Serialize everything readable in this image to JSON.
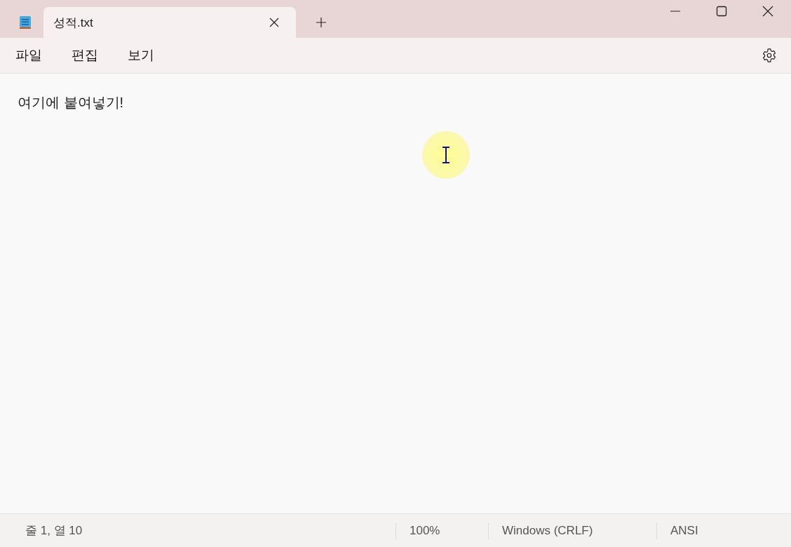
{
  "tabs": [
    {
      "label": "성적.txt",
      "selected": true
    }
  ],
  "menu": [
    "파일",
    "편집",
    "보기"
  ],
  "editor": {
    "text": "여기에 붙여넣기!"
  },
  "status_bar": {
    "position": "줄 1, 열 10",
    "zoom": "100%",
    "line_ending": "Windows (CRLF)",
    "encoding": "ANSI"
  }
}
